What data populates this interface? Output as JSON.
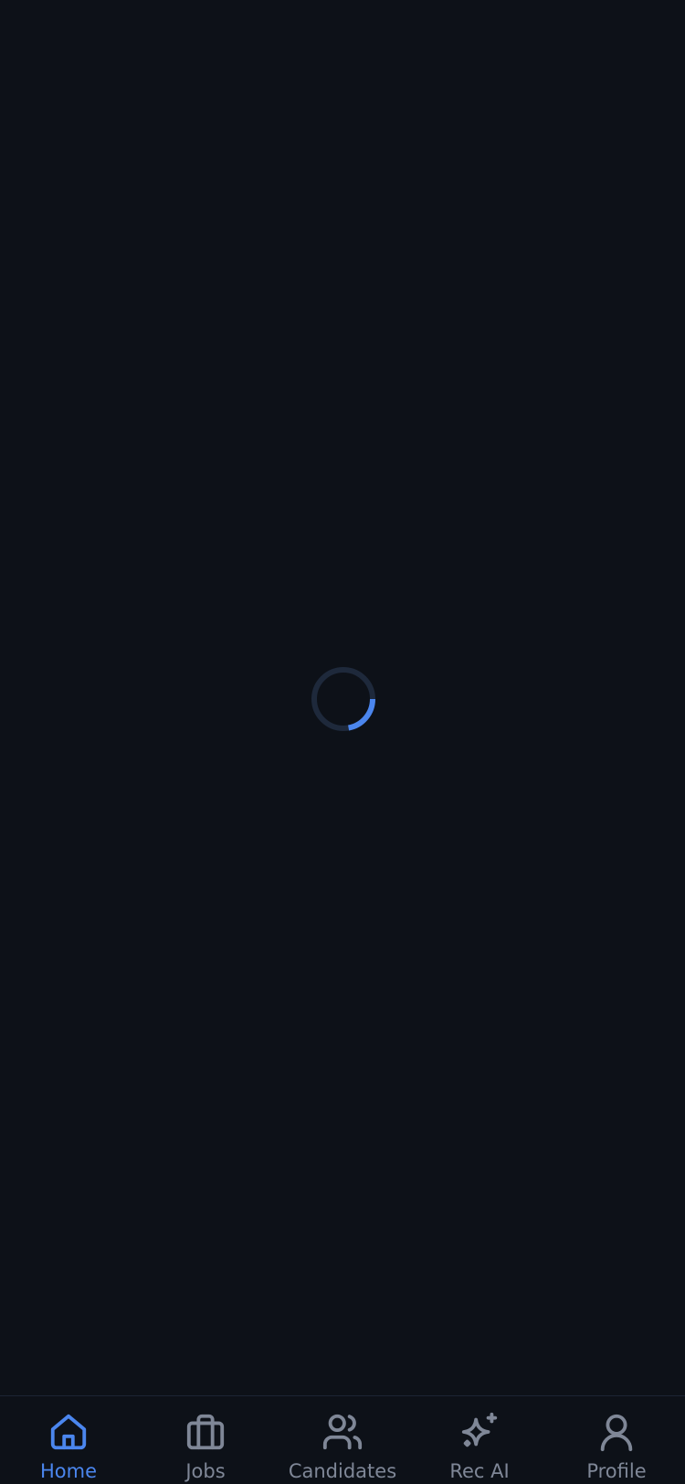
{
  "theme": {
    "background": "#0d1118",
    "accent": "#4b86ee",
    "inactive": "#7f8797",
    "spinner_track": "#1e293b"
  },
  "loading": {
    "indicator": "spinner",
    "state": "loading"
  },
  "tabbar": {
    "active": "home",
    "tabs": [
      {
        "key": "home",
        "label": "Home",
        "icon": "home-icon"
      },
      {
        "key": "jobs",
        "label": "Jobs",
        "icon": "briefcase-icon"
      },
      {
        "key": "candidates",
        "label": "Candidates",
        "icon": "users-icon"
      },
      {
        "key": "rec_ai",
        "label": "Rec AI",
        "icon": "sparkles-icon"
      },
      {
        "key": "profile",
        "label": "Profile",
        "icon": "user-icon"
      }
    ]
  }
}
